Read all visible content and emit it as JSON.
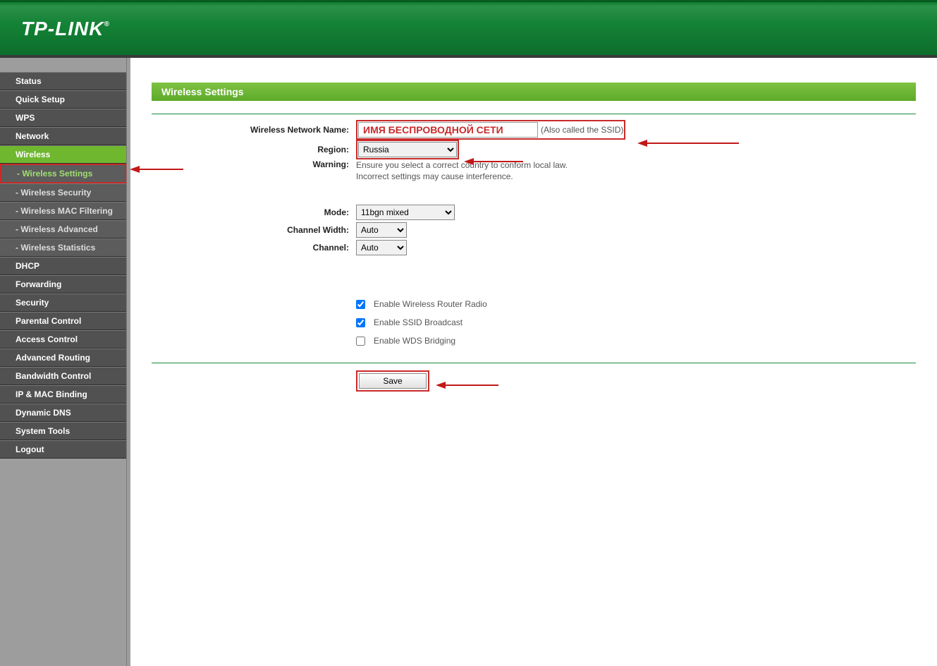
{
  "brand": "TP-LINK",
  "sidebar": {
    "items": [
      {
        "label": "Status",
        "type": "top"
      },
      {
        "label": "Quick Setup",
        "type": "top"
      },
      {
        "label": "WPS",
        "type": "top"
      },
      {
        "label": "Network",
        "type": "top"
      },
      {
        "label": "Wireless",
        "type": "top",
        "active": true
      },
      {
        "label": "- Wireless Settings",
        "type": "sub",
        "active": true
      },
      {
        "label": "- Wireless Security",
        "type": "sub"
      },
      {
        "label": "- Wireless MAC Filtering",
        "type": "sub"
      },
      {
        "label": "- Wireless Advanced",
        "type": "sub"
      },
      {
        "label": "- Wireless Statistics",
        "type": "sub"
      },
      {
        "label": "DHCP",
        "type": "top"
      },
      {
        "label": "Forwarding",
        "type": "top"
      },
      {
        "label": "Security",
        "type": "top"
      },
      {
        "label": "Parental Control",
        "type": "top"
      },
      {
        "label": "Access Control",
        "type": "top"
      },
      {
        "label": "Advanced Routing",
        "type": "top"
      },
      {
        "label": "Bandwidth Control",
        "type": "top"
      },
      {
        "label": "IP & MAC Binding",
        "type": "top"
      },
      {
        "label": "Dynamic DNS",
        "type": "top"
      },
      {
        "label": "System Tools",
        "type": "top"
      },
      {
        "label": "Logout",
        "type": "top"
      }
    ]
  },
  "page": {
    "title": "Wireless Settings",
    "labels": {
      "ssid": "Wireless Network Name:",
      "ssid_note": "(Also called the SSID)",
      "region": "Region:",
      "warning": "Warning:",
      "warning_text_1": "Ensure you select a correct country to conform local law.",
      "warning_text_2": "Incorrect settings may cause interference.",
      "mode": "Mode:",
      "channel_width": "Channel Width:",
      "channel": "Channel:"
    },
    "values": {
      "ssid": "ИМЯ БЕСПРОВОДНОЙ СЕТИ",
      "region": "Russia",
      "mode": "11bgn mixed",
      "channel_width": "Auto",
      "channel": "Auto"
    },
    "checkboxes": {
      "radio": {
        "label": "Enable Wireless Router Radio",
        "checked": true
      },
      "ssid_bcast": {
        "label": "Enable SSID Broadcast",
        "checked": true
      },
      "wds": {
        "label": "Enable WDS Bridging",
        "checked": false
      }
    },
    "buttons": {
      "save": "Save"
    }
  }
}
